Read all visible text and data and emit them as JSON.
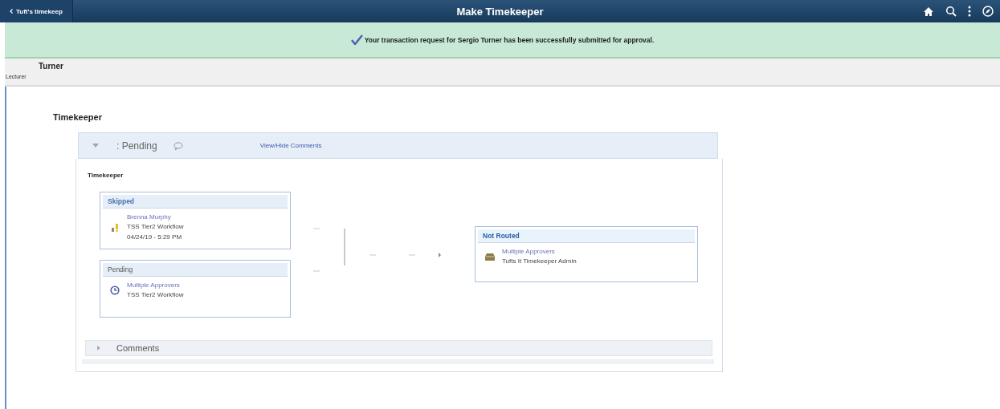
{
  "header": {
    "back_label": "Tuft's timekeep",
    "title": "Make Timekeeper"
  },
  "banner": {
    "message": "Your transaction request for Sergio Turner has been successfully submitted for approval."
  },
  "person": {
    "name": "Turner",
    "role": "Lecturer"
  },
  "section_title": "Timekeeper",
  "approval": {
    "expanded": true,
    "status": ": Pending",
    "toggle_link": "View/Hide Comments",
    "label": "Timekeeper",
    "parallel_steps": [
      {
        "kind": "skipped",
        "status": "Skipped",
        "approver": "Brenna Murphy",
        "workflow": "TSS Tier2 Workflow",
        "date": "04/24/19 - 5:29 PM"
      },
      {
        "kind": "pending",
        "status": "Pending",
        "approver": "Multiple Approvers",
        "workflow": "TSS Tier2 Workflow"
      }
    ],
    "next_step": {
      "kind": "not-routed",
      "status": "Not Routed",
      "approver": "Multiple Approvers",
      "workflow": "Tufts It Timekeeper Admin"
    },
    "comments": {
      "label": "Comments",
      "expanded": false
    }
  }
}
